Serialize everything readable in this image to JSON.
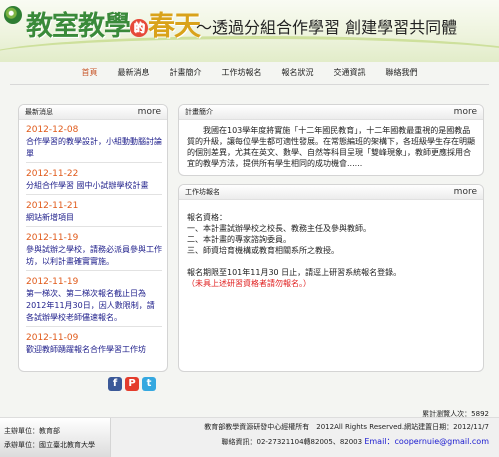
{
  "header": {
    "brand_part1": "教室教學",
    "brand_de": "的",
    "brand_part2": "春天",
    "subtitle": "～透過分組合作學習 創建學習共同體"
  },
  "nav": {
    "items": [
      "首頁",
      "最新消息",
      "計畫簡介",
      "工作坊報名",
      "報名狀況",
      "交通資訊",
      "聯絡我們"
    ],
    "active_index": 0
  },
  "news": {
    "title": "最新消息",
    "more": "more",
    "items": [
      {
        "date": "2012-12-08",
        "title": "合作學習的教學設計，小組動動腦討論單"
      },
      {
        "date": "2012-11-22",
        "title": "分組合作學習 國中小試辦學校計畫"
      },
      {
        "date": "2012-11-21",
        "title": "網站新增項目"
      },
      {
        "date": "2012-11-19",
        "title": "參與試辦之學校，請務必派員參與工作坊，以利計畫確實實施。"
      },
      {
        "date": "2012-11-19",
        "title": "第一梯次、第二梯次報名截止日為2012年11月30日，因人數限制，請各試辦學校老師儘速報名。"
      },
      {
        "date": "2012-11-09",
        "title": "歡迎教師踴躍報名合作學習工作坊"
      }
    ]
  },
  "plan": {
    "title": "計畫簡介",
    "more": "more",
    "text": "我國在103學年度將實施「十二年國民教育」，十二年國教最重視的是國教品質的升級，讓每位學生都可適性發展。在常態編班的架構下，各班級學生存在明顯的個別差異，尤其在英文、數學、自然等科目呈現「雙峰現象」，教師更應採用合宜的教學方法，提供所有學生相同的成功機會......"
  },
  "workshop": {
    "title": "工作坊報名",
    "more": "more",
    "qual_title": "報名資格：",
    "qual_lines": [
      "一、本計畫試辦學校之校長、教務主任及參與教師。",
      "二、本計畫的專家諮詢委員。",
      "三、師資培育機構或教育相關系所之教授。"
    ],
    "deadline": "報名期限至101年11月30 日止，請逕上研習系統報名登錄。",
    "note": "（未具上述研習資格者請勿報名。）"
  },
  "social": {
    "icons": [
      "facebook-icon",
      "plurk-icon",
      "twitter-icon"
    ],
    "glyphs": [
      "f",
      "P",
      "t"
    ]
  },
  "footer": {
    "visits": "累計瀏覽人次：5892",
    "sponsor": "主辦單位：教育部",
    "organizer": "承辦單位：國立臺北教育大學",
    "copyright": "教育部教學資源研發中心經權所有　2012All Rights Reserved.網站建置日期：2012/11/7",
    "phone": "聯絡資訊：02-27321104轉82005、82003",
    "email": "Email：coopernuie@gmail.com"
  }
}
